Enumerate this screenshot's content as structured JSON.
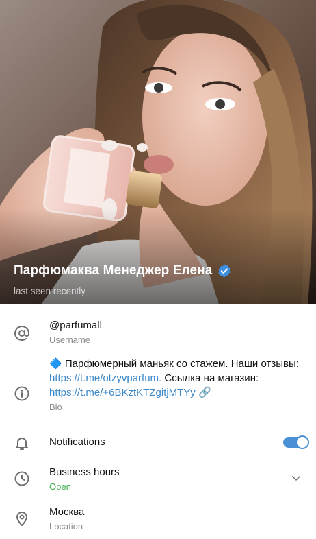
{
  "profile": {
    "name": "Парфюмаква Менеджер Елена",
    "status": "last seen recently",
    "verified": true
  },
  "username": {
    "value": "@parfumall",
    "label": "Username"
  },
  "bio": {
    "emoji": "🔷",
    "text_1": " Парфюмерный маньяк со стажем. Наши отзывы: ",
    "link_1": "https://t.me/otzyvparfum.",
    "text_2": " Ссылка на магазин: ",
    "link_2": "https://t.me/+6BKztKTZgitjMTYy",
    "emoji_end": " 🔗",
    "label": "Bio"
  },
  "notifications": {
    "label": "Notifications",
    "enabled": true
  },
  "business_hours": {
    "label": "Business hours",
    "status": "Open"
  },
  "location": {
    "value": "Москва",
    "label": "Location"
  },
  "colors": {
    "accent": "#4a90d6",
    "link": "#3b87c8",
    "open": "#3cab4b",
    "verified": "#3d8fe0"
  }
}
